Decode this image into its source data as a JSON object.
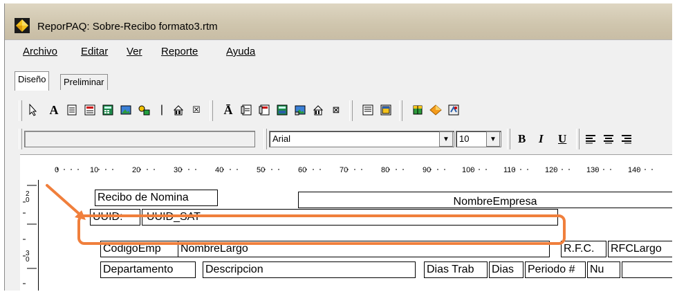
{
  "window": {
    "title": "ReporPAQ: Sobre-Recibo formato3.rtm"
  },
  "menu": [
    {
      "label": "Archivo"
    },
    {
      "label": "Editar"
    },
    {
      "label": "Ver"
    },
    {
      "label": "Reporte"
    },
    {
      "label": "Ayuda"
    }
  ],
  "tabs": [
    {
      "label": "Diseño",
      "active": true
    },
    {
      "label": "Preliminar",
      "active": false
    }
  ],
  "format_toolbar": {
    "font_name": "Arial",
    "font_size": "10",
    "bold": "B",
    "italic": "I",
    "underline": "U"
  },
  "ruler": {
    "marks": [
      "0",
      "10",
      "20",
      "30",
      "40",
      "50",
      "60",
      "70",
      "80",
      "90",
      "100",
      "110",
      "120",
      "130",
      "140"
    ],
    "vertical_marks": [
      "2\n0",
      "3\n0"
    ]
  },
  "report_fields": {
    "recibo_title": "Recibo de Nomina",
    "nombre_empresa": "NombreEmpresa",
    "uuid_label": "UUID:",
    "uuid_value": "UUID_SAT",
    "codigo_emp": "CodigoEmp",
    "nombre_largo": "NombreLargo",
    "rfc_label": "R.F.C.",
    "rfc_largo": "RFCLargo",
    "departamento": "Departamento",
    "descripcion": "Descripcion",
    "dias_trab": "Dias Trab",
    "dias": "Dias",
    "periodo": "Periodo #",
    "nu": "Nu"
  },
  "colors": {
    "highlight": "#f07f3c",
    "title_bar": "#d3c9b2",
    "chrome": "#f0f0f0"
  }
}
